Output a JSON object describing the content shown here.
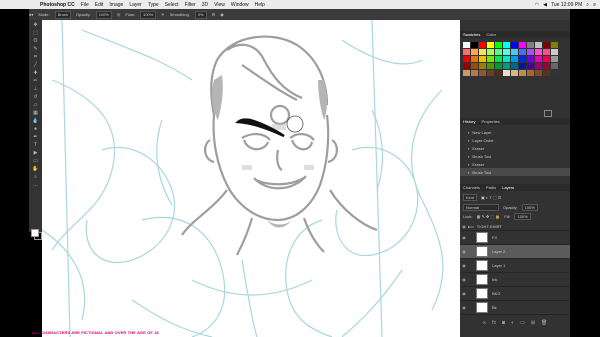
{
  "menubar": {
    "app_name": "Photoshop CC",
    "items": [
      "File",
      "Edit",
      "Image",
      "Layer",
      "Type",
      "Select",
      "Filter",
      "3D",
      "View",
      "Window",
      "Help"
    ],
    "clock": "Tue 12:09 PM"
  },
  "options": {
    "mode_label": "Mode:",
    "mode_value": "Brush",
    "opacity_label": "Opacity:",
    "opacity_value": "100%",
    "flow_label": "Flow:",
    "flow_value": "100%",
    "smoothing_label": "Smoothing:",
    "smoothing_value": "0%"
  },
  "swatches_panel": {
    "tabs": [
      "Swatches",
      "Color"
    ],
    "colors": [
      "#ffffff",
      "#000000",
      "#ff0000",
      "#ffff00",
      "#00ff00",
      "#00ffff",
      "#0000ff",
      "#ff00ff",
      "#808080",
      "#c0c0c0",
      "#800000",
      "#808000",
      "#ff6a6a",
      "#ffa64d",
      "#ffe14d",
      "#a6ff4d",
      "#4dff88",
      "#4dffe1",
      "#4dc3ff",
      "#4d6aff",
      "#a64dff",
      "#ff4dd2",
      "#ff4d88",
      "#cccccc",
      "#e60000",
      "#e67300",
      "#e6c300",
      "#73e600",
      "#00e64d",
      "#00e6c3",
      "#0099e6",
      "#0026e6",
      "#7300e6",
      "#e600b8",
      "#e6004d",
      "#999999",
      "#990000",
      "#994d00",
      "#998200",
      "#4d9900",
      "#009933",
      "#009982",
      "#006699",
      "#001a99",
      "#4d0099",
      "#99007a",
      "#990033",
      "#666666",
      "#cc9966",
      "#b37a4d",
      "#8c5a33",
      "#664026",
      "#4d2e1a",
      "#f2d9c2",
      "#d9b38c",
      "#bf8c59",
      "#a66633",
      "#804d26",
      "#5c3319",
      "#333333"
    ]
  },
  "history_panel": {
    "tabs": [
      "History",
      "Properties"
    ],
    "items": [
      "New Layer",
      "Layer Order",
      "Eraser",
      "Brush Tool",
      "Eraser",
      "Brush Tool"
    ]
  },
  "layers_panel": {
    "tabs": [
      "Channels",
      "Paths",
      "Layers"
    ],
    "kind_label": "Kind",
    "blend_mode": "Normal",
    "opacity_label": "Opacity:",
    "opacity_value": "100%",
    "lock_label": "Lock:",
    "fill_label": "Fill:",
    "fill_value": "100%",
    "group_name": "TIGHT-SHIRT",
    "layers": [
      {
        "name": "FX",
        "selected": false
      },
      {
        "name": "Layer 2",
        "selected": true
      },
      {
        "name": "Layer 1",
        "selected": false
      },
      {
        "name": "Ink",
        "selected": false
      },
      {
        "name": "BKG",
        "selected": false
      },
      {
        "name": "Bk",
        "selected": false
      }
    ]
  },
  "footer_notice": "ALL CHARACTERS ARE FICTIONAL AND OVER THE AGE OF 18"
}
